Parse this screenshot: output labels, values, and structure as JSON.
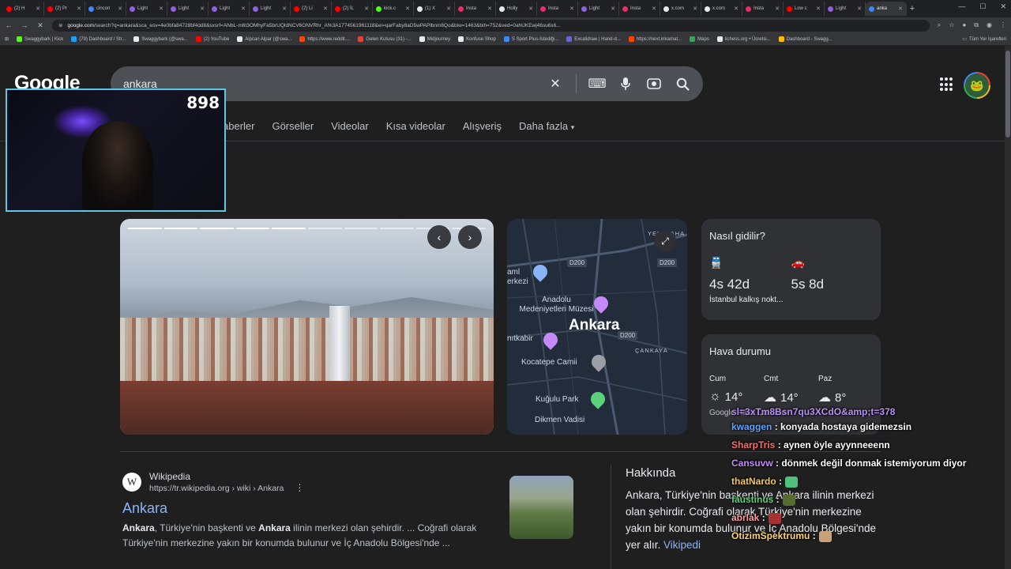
{
  "browser": {
    "tabs": [
      {
        "label": "(2) H",
        "color": "#ff0000"
      },
      {
        "label": "(2) Pr",
        "color": "#ff0000"
      },
      {
        "label": "cincon",
        "color": "#4285f4"
      },
      {
        "label": "Light",
        "color": "#8e63d6"
      },
      {
        "label": "Light",
        "color": "#8e63d6"
      },
      {
        "label": "Light",
        "color": "#8e63d6"
      },
      {
        "label": "Light",
        "color": "#8e63d6"
      },
      {
        "label": "(2) Li",
        "color": "#ff0000"
      },
      {
        "label": "(2) İL",
        "color": "#ff0000"
      },
      {
        "label": "kick.c",
        "color": "#53fc18"
      },
      {
        "label": "(1) X",
        "color": "#e8eaed"
      },
      {
        "label": "Insta",
        "color": "#e1306c"
      },
      {
        "label": "Holly",
        "color": "#e8eaed"
      },
      {
        "label": "Insta",
        "color": "#e1306c"
      },
      {
        "label": "Light",
        "color": "#8e63d6"
      },
      {
        "label": "Insta",
        "color": "#e1306c"
      },
      {
        "label": "x.com",
        "color": "#e8eaed"
      },
      {
        "label": "x.com",
        "color": "#e8eaed"
      },
      {
        "label": "Insta",
        "color": "#e1306c"
      },
      {
        "label": "Low c",
        "color": "#ff0000"
      },
      {
        "label": "Light",
        "color": "#8e63d6"
      },
      {
        "label": "anka",
        "color": "#4285f4"
      }
    ],
    "url_host": "google.com",
    "url_rest": "/search?q=ankara&sca_esv=4e0bfa84728bf4dd8&sxsrf=ANbL-m6t3OMhyFa5brUQldNCV6ONVRhr_A%3A1774561961118&ei=qarFaby8aD5wPAPlbnm8Qo&biw=1463&bih=752&ved=0ahUKEwj46su6x6...",
    "bookmarks": [
      {
        "label": "Swaggybark | Kick",
        "color": "#53fc18"
      },
      {
        "label": "(79) Dashboard / Str...",
        "color": "#1da1f2"
      },
      {
        "label": "Swaggybark (@swa...",
        "color": "#e8eaed"
      },
      {
        "label": "(2) YouTube",
        "color": "#ff0000"
      },
      {
        "label": "Alpcan Alpar (@swa...",
        "color": "#e8eaed"
      },
      {
        "label": "https://www.reddit....",
        "color": "#ff4500"
      },
      {
        "label": "Gelen Kutusu (31) -...",
        "color": "#ea4335"
      },
      {
        "label": "Midjourney",
        "color": "#e8eaed"
      },
      {
        "label": "Konfuse Shop",
        "color": "#e8eaed"
      },
      {
        "label": "S Sport Plus-İstediği...",
        "color": "#4285f4"
      },
      {
        "label": "Excalidraw | Hand-d...",
        "color": "#6965db"
      },
      {
        "label": "https://next.inkarnat...",
        "color": "#ff4500"
      },
      {
        "label": "Maps",
        "color": "#34a853"
      },
      {
        "label": "lichess.org • Ücretsi...",
        "color": "#e8eaed"
      },
      {
        "label": "Dashboard - Swagg...",
        "color": "#fbbc05"
      }
    ],
    "bookmarks_other": "Tüm Yer İşaretleri"
  },
  "google": {
    "logo": "Google",
    "query": "ankara",
    "nav_tabs": [
      "aberler",
      "Görseller",
      "Videolar",
      "Kısa videolar",
      "Alışveriş",
      "Daha fazla"
    ]
  },
  "overlay": {
    "viewer_count": "898"
  },
  "map": {
    "title": "Ankara",
    "labels": {
      "yenimahalle": "YENİMAHA",
      "d200a": "D200",
      "d200b": "D200",
      "d200c": "D200",
      "museum": "Anadolu\nMedeniyetleri Müzesi",
      "merkezi": "aml\nerkezi",
      "anitkabir": "nıtkabir",
      "cankaya": "ÇANKAYA",
      "kocatepe": "Kocatepe Camii",
      "kugulu": "Kuğulu Park",
      "dikmen": "Dikmen Vadisi"
    }
  },
  "travel": {
    "title": "Nasıl gidilir?",
    "options": [
      {
        "icon": "train-icon",
        "duration": "4s 42d",
        "sub": "İstanbul kalkış nokt..."
      },
      {
        "icon": "car-icon",
        "duration": "5s 8d",
        "sub": ""
      }
    ]
  },
  "weather": {
    "title": "Hava durumu",
    "days": [
      {
        "day": "Cum",
        "temp": "14°",
        "icon": "sun-icon"
      },
      {
        "day": "Cmt",
        "temp": "14°",
        "icon": "cloud-rain-icon"
      },
      {
        "day": "Paz",
        "temp": "8°",
        "icon": "cloud-rain-icon"
      }
    ],
    "source": "Google Hava Durumu"
  },
  "result": {
    "site": "Wikipedia",
    "url": "https://tr.wikipedia.org › wiki › Ankara",
    "title": "Ankara",
    "snippet_b1": "Ankara",
    "snippet_t1": ", Türkiye'nin başkenti ve ",
    "snippet_b2": "Ankara",
    "snippet_t2": " ilinin merkezi olan şehirdir. ... Coğrafi olarak Türkiye'nin merkezine yakın bir konumda bulunur ve İç Anadolu Bölgesi'nde ..."
  },
  "about": {
    "title": "Hakkında",
    "text": "Ankara, Türkiye'nin başkenti ve Ankara ilinin merkezi olan şehirdir. Coğrafi olarak Türkiye'nin merkezine yakın bir konumda bulunur ve İç Anadolu Bölgesi'nde yer alır. ",
    "link": "Vikipedi"
  },
  "chat": {
    "overflow": "sl=3xTm8Bsn7qu3XCdO&amp;t=378",
    "messages": [
      {
        "user": "kwaggen",
        "text": " : konyada hostaya gidemezsin"
      },
      {
        "user": "SharpTris",
        "text": " : aynen öyle ayynneeenn"
      },
      {
        "user": "Cansuvw",
        "text": " : dönmek değil donmak istemiyorum diyor"
      },
      {
        "user": "thatNardo",
        "text": " :"
      },
      {
        "user": "faustinus",
        "text": " :"
      },
      {
        "user": "abrlak",
        "text": " :"
      },
      {
        "user": "OtizimSpektrumu",
        "text": " :"
      }
    ]
  }
}
